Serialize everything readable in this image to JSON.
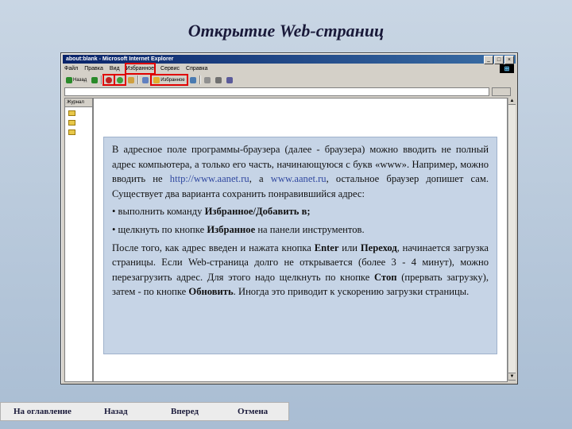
{
  "slide_title": "Открытие Web-страниц",
  "browser": {
    "title": "about:blank - Microsoft Internet Explorer",
    "menu": [
      "Файл",
      "Правка",
      "Вид",
      "Избранное",
      "Сервис",
      "Справка"
    ],
    "toolbar": {
      "back": "Назад",
      "favorites": "Избранное"
    },
    "sidepanel": {
      "header": "Журнал"
    }
  },
  "text": {
    "p1_before": "В адресное поле программы-браузера (далее - браузера) можно вводить не полный адрес компьютера, а только его часть, начинающуюся с букв «www». Например, можно вводить не ",
    "url1": "http://www.aanet.ru",
    "p1_mid": ", а ",
    "url2": "www.aanet.ru",
    "p1_after": ", остальное браузер допишет сам. Существует два варианта сохранить понравившийся адрес:",
    "b1_before": "• выполнить команду ",
    "b1_bold": "Избранное/Добавить в;",
    "b2_before": "• щелкнуть по кнопке ",
    "b2_bold": "Избранное",
    "b2_after": " на панели инструментов.",
    "p2_a": "После того, как адрес введен и нажата кнопка ",
    "p2_enter": "Enter",
    "p2_b": " или ",
    "p2_go": "Переход",
    "p2_c": ", начинается загрузка страницы. Если Web-страница долго не открывается (более 3 - 4 минут), можно перезагрузить адрес. Для этого надо щелкнуть по кнопке ",
    "p2_stop": "Стоп",
    "p2_d": " (прервать загрузку), затем - по кнопке ",
    "p2_refresh": "Обновить",
    "p2_e": ". Иногда это приводит к ускорению загрузки страницы."
  },
  "nav": {
    "toc": "На оглавление",
    "back": "Назад",
    "forward": "Вперед",
    "cancel": "Отмена"
  },
  "colors": {
    "highlight": "#e00000",
    "textbox_bg": "#c6d4e6",
    "titlebar": "#0a246a"
  }
}
